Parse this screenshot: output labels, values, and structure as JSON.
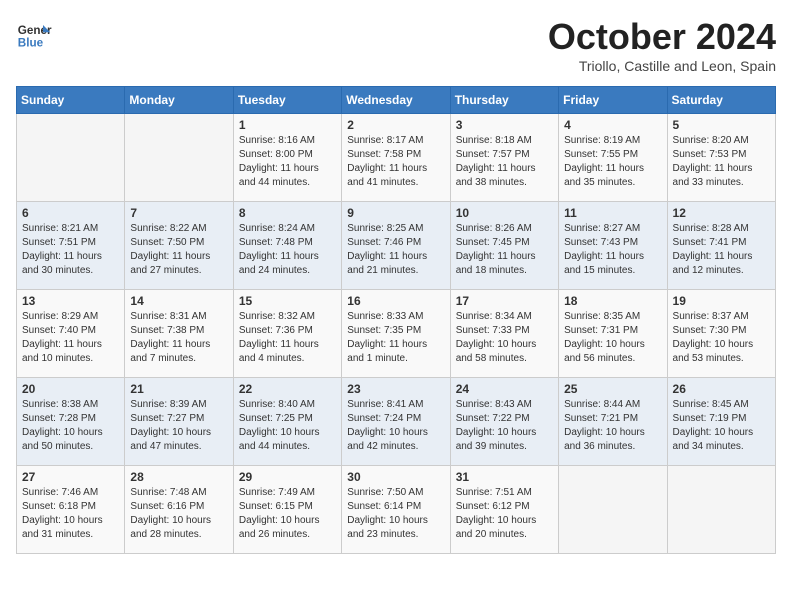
{
  "header": {
    "logo_line1": "General",
    "logo_line2": "Blue",
    "month": "October 2024",
    "location": "Triollo, Castille and Leon, Spain"
  },
  "weekdays": [
    "Sunday",
    "Monday",
    "Tuesday",
    "Wednesday",
    "Thursday",
    "Friday",
    "Saturday"
  ],
  "weeks": [
    [
      {
        "day": "",
        "info": ""
      },
      {
        "day": "",
        "info": ""
      },
      {
        "day": "1",
        "info": "Sunrise: 8:16 AM\nSunset: 8:00 PM\nDaylight: 11 hours and 44 minutes."
      },
      {
        "day": "2",
        "info": "Sunrise: 8:17 AM\nSunset: 7:58 PM\nDaylight: 11 hours and 41 minutes."
      },
      {
        "day": "3",
        "info": "Sunrise: 8:18 AM\nSunset: 7:57 PM\nDaylight: 11 hours and 38 minutes."
      },
      {
        "day": "4",
        "info": "Sunrise: 8:19 AM\nSunset: 7:55 PM\nDaylight: 11 hours and 35 minutes."
      },
      {
        "day": "5",
        "info": "Sunrise: 8:20 AM\nSunset: 7:53 PM\nDaylight: 11 hours and 33 minutes."
      }
    ],
    [
      {
        "day": "6",
        "info": "Sunrise: 8:21 AM\nSunset: 7:51 PM\nDaylight: 11 hours and 30 minutes."
      },
      {
        "day": "7",
        "info": "Sunrise: 8:22 AM\nSunset: 7:50 PM\nDaylight: 11 hours and 27 minutes."
      },
      {
        "day": "8",
        "info": "Sunrise: 8:24 AM\nSunset: 7:48 PM\nDaylight: 11 hours and 24 minutes."
      },
      {
        "day": "9",
        "info": "Sunrise: 8:25 AM\nSunset: 7:46 PM\nDaylight: 11 hours and 21 minutes."
      },
      {
        "day": "10",
        "info": "Sunrise: 8:26 AM\nSunset: 7:45 PM\nDaylight: 11 hours and 18 minutes."
      },
      {
        "day": "11",
        "info": "Sunrise: 8:27 AM\nSunset: 7:43 PM\nDaylight: 11 hours and 15 minutes."
      },
      {
        "day": "12",
        "info": "Sunrise: 8:28 AM\nSunset: 7:41 PM\nDaylight: 11 hours and 12 minutes."
      }
    ],
    [
      {
        "day": "13",
        "info": "Sunrise: 8:29 AM\nSunset: 7:40 PM\nDaylight: 11 hours and 10 minutes."
      },
      {
        "day": "14",
        "info": "Sunrise: 8:31 AM\nSunset: 7:38 PM\nDaylight: 11 hours and 7 minutes."
      },
      {
        "day": "15",
        "info": "Sunrise: 8:32 AM\nSunset: 7:36 PM\nDaylight: 11 hours and 4 minutes."
      },
      {
        "day": "16",
        "info": "Sunrise: 8:33 AM\nSunset: 7:35 PM\nDaylight: 11 hours and 1 minute."
      },
      {
        "day": "17",
        "info": "Sunrise: 8:34 AM\nSunset: 7:33 PM\nDaylight: 10 hours and 58 minutes."
      },
      {
        "day": "18",
        "info": "Sunrise: 8:35 AM\nSunset: 7:31 PM\nDaylight: 10 hours and 56 minutes."
      },
      {
        "day": "19",
        "info": "Sunrise: 8:37 AM\nSunset: 7:30 PM\nDaylight: 10 hours and 53 minutes."
      }
    ],
    [
      {
        "day": "20",
        "info": "Sunrise: 8:38 AM\nSunset: 7:28 PM\nDaylight: 10 hours and 50 minutes."
      },
      {
        "day": "21",
        "info": "Sunrise: 8:39 AM\nSunset: 7:27 PM\nDaylight: 10 hours and 47 minutes."
      },
      {
        "day": "22",
        "info": "Sunrise: 8:40 AM\nSunset: 7:25 PM\nDaylight: 10 hours and 44 minutes."
      },
      {
        "day": "23",
        "info": "Sunrise: 8:41 AM\nSunset: 7:24 PM\nDaylight: 10 hours and 42 minutes."
      },
      {
        "day": "24",
        "info": "Sunrise: 8:43 AM\nSunset: 7:22 PM\nDaylight: 10 hours and 39 minutes."
      },
      {
        "day": "25",
        "info": "Sunrise: 8:44 AM\nSunset: 7:21 PM\nDaylight: 10 hours and 36 minutes."
      },
      {
        "day": "26",
        "info": "Sunrise: 8:45 AM\nSunset: 7:19 PM\nDaylight: 10 hours and 34 minutes."
      }
    ],
    [
      {
        "day": "27",
        "info": "Sunrise: 7:46 AM\nSunset: 6:18 PM\nDaylight: 10 hours and 31 minutes."
      },
      {
        "day": "28",
        "info": "Sunrise: 7:48 AM\nSunset: 6:16 PM\nDaylight: 10 hours and 28 minutes."
      },
      {
        "day": "29",
        "info": "Sunrise: 7:49 AM\nSunset: 6:15 PM\nDaylight: 10 hours and 26 minutes."
      },
      {
        "day": "30",
        "info": "Sunrise: 7:50 AM\nSunset: 6:14 PM\nDaylight: 10 hours and 23 minutes."
      },
      {
        "day": "31",
        "info": "Sunrise: 7:51 AM\nSunset: 6:12 PM\nDaylight: 10 hours and 20 minutes."
      },
      {
        "day": "",
        "info": ""
      },
      {
        "day": "",
        "info": ""
      }
    ]
  ]
}
